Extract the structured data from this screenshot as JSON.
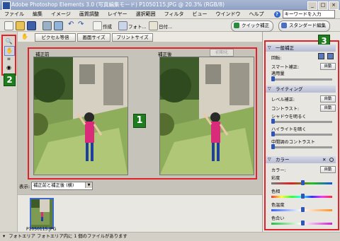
{
  "titlebar": {
    "title": "Adobe Photoshop Elements 3.0 (写真編集モード) P1050115.JPG @ 20.3% (RGB/8)"
  },
  "menubar": {
    "items": [
      "ファイル",
      "編集",
      "イメージ",
      "画質調整",
      "レイヤー",
      "選択範囲",
      "フィルタ",
      "ビュー",
      "ウインドウ",
      "ヘルプ"
    ],
    "search_placeholder": "キーワードを入力"
  },
  "toolbar": {
    "create_label": "作成",
    "photo_label": "フォト...",
    "date_label": "日付...",
    "quick_fix_label": "クイック補正",
    "standard_edit_label": "スタンダード編集"
  },
  "options": {
    "pixel_btn": "ピクセル等倍",
    "screen_btn": "画面サイズ",
    "print_btn": "プリントサイズ"
  },
  "workspace": {
    "before_label": "補正前",
    "after_label": "補正後",
    "reset_label": "初期化"
  },
  "viewbar": {
    "label": "表示:",
    "value": "補正前と補正後 (横)"
  },
  "photobin": {
    "filename": "P1050115.JPG"
  },
  "statusbar": {
    "text": "フォトエリア  フォトエリア内に 1 個のファイルがあります"
  },
  "badges": {
    "one": "1",
    "two": "2",
    "three": "3"
  },
  "palette": {
    "general": {
      "title": "一般補正",
      "rotate_label": "回転:",
      "smart_fix_label": "スマート補正:",
      "apply_label": "適用量",
      "auto_label": "自動"
    },
    "lighting": {
      "title": "ライティング",
      "levels_label": "レベル補正:",
      "contrast_label": "コントラスト:",
      "shadow_label": "シャドウを明るく",
      "highlight_label": "ハイライトを暗く",
      "midtone_label": "中間調のコントラスト",
      "auto_label": "自動"
    },
    "color": {
      "title": "カラー",
      "color_label": "カラー:",
      "saturation_label": "彩度",
      "hue_label": "色相",
      "temperature_label": "色温度",
      "tint_label": "色合い",
      "auto_label": "自動"
    }
  },
  "colors": {
    "accent_red": "#e0232b",
    "badge_green": "#1f7d1f",
    "header_blue": "#b6bbd3"
  }
}
